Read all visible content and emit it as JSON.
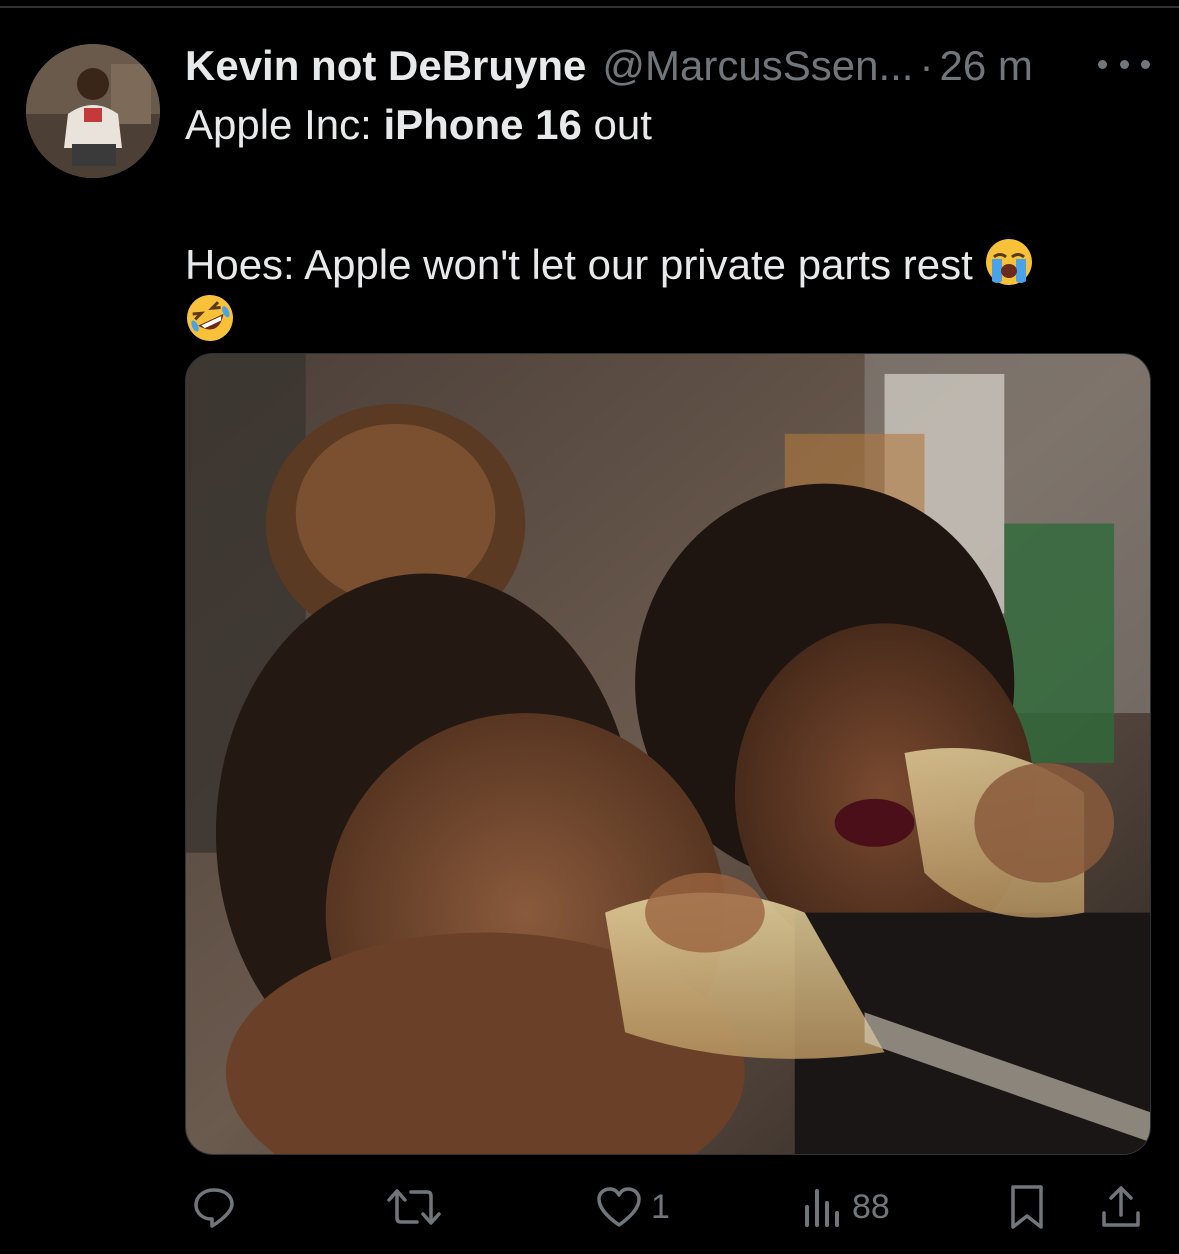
{
  "tweet": {
    "display_name": "Kevin not DeBruyne",
    "handle": "@MarcusSsen...",
    "separator": "·",
    "time": "26 m",
    "text_line1_prefix": "Apple Inc: ",
    "text_line1_bold": "iPhone 16",
    "text_line1_suffix": " out",
    "text_line2": "Hoes: Apple won't let our private parts rest",
    "emojis": [
      "loudly-crying-face",
      "rolling-on-floor-laughing"
    ]
  },
  "actions": {
    "reply_count": "",
    "repost_count": "",
    "like_count": "1",
    "views_count": "88"
  },
  "colors": {
    "background": "#000000",
    "text": "#e7e9ea",
    "muted": "#71767b",
    "divider": "#2f3336"
  }
}
